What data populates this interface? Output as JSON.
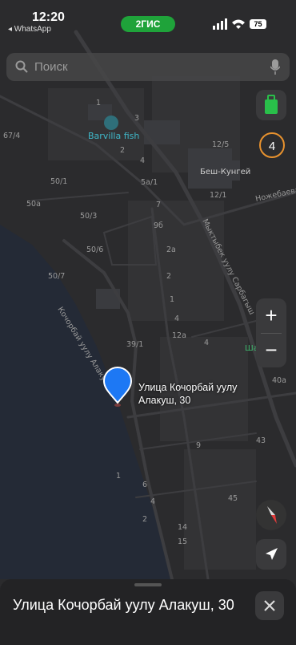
{
  "status_bar": {
    "time": "12:20",
    "back_app": "◂ WhatsApp",
    "center_pill": "2ГИС",
    "battery": "75"
  },
  "search": {
    "placeholder": "Поиск"
  },
  "map": {
    "poi_labels": {
      "barvilla": "Barvilla fish",
      "besh_kungei": "Беш-Кунгей"
    },
    "street_labels": {
      "kochorbay": "Кочорбай уулу Алаку",
      "myktybek": "Мыктыбек уулу Сарбагыш",
      "nozhebaeva": "Ножебаева",
      "sha": "Ша"
    },
    "house_numbers": [
      "67/4",
      "1",
      "2",
      "3",
      "4",
      "12/5",
      "12/1",
      "50/1",
      "50a",
      "50/3",
      "50/6",
      "50/7",
      "5a/1",
      "7",
      "9б",
      "2a",
      "2",
      "1",
      "4",
      "39/1",
      "12a",
      "4",
      "40a",
      "43",
      "9",
      "6",
      "4",
      "1",
      "2",
      "45",
      "14",
      "15"
    ]
  },
  "controls": {
    "traffic_score": "4",
    "zoom_in": "+",
    "zoom_out": "−"
  },
  "selected_pin": {
    "label": "Улица Кочорбай уулу Алакуш, 30"
  },
  "bottom_sheet": {
    "title": "Улица Кочорбай уулу Алакуш, 30"
  }
}
